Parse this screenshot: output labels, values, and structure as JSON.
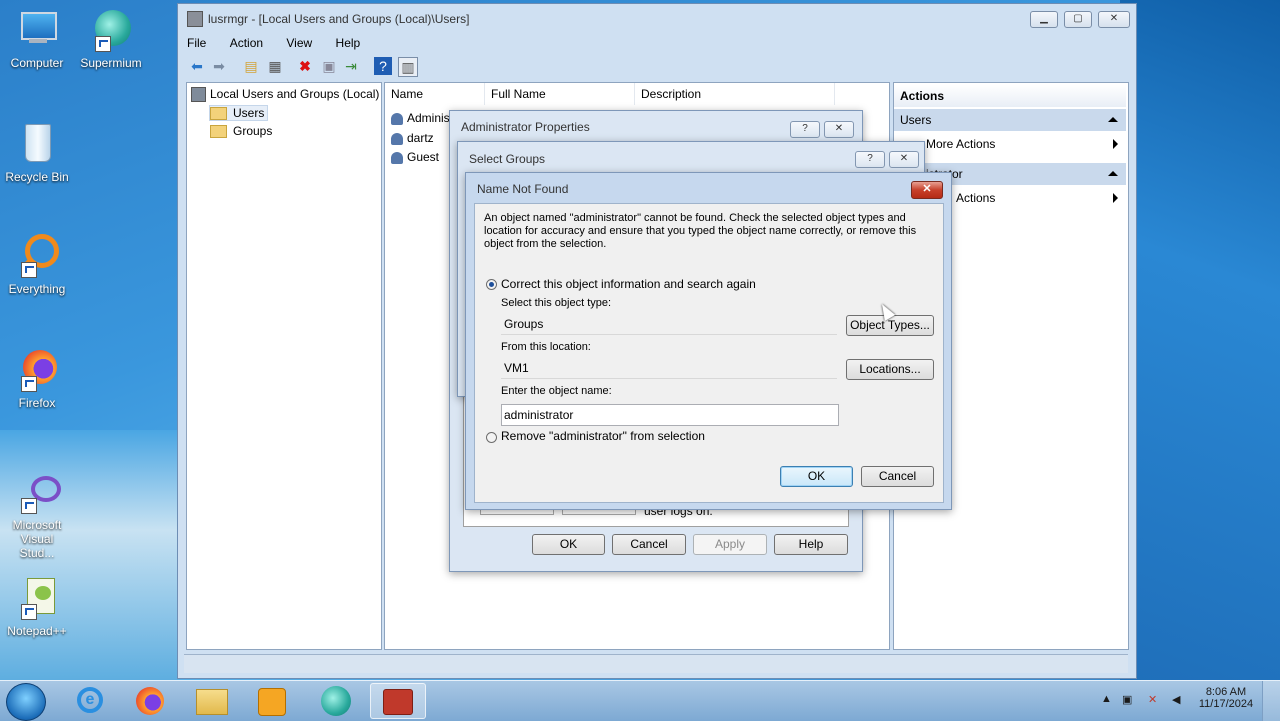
{
  "desktop": {
    "icons": [
      {
        "label": "Computer"
      },
      {
        "label": "Supermium"
      },
      {
        "label": "Recycle Bin"
      },
      {
        "label": "Everything"
      },
      {
        "label": "Firefox"
      },
      {
        "label": "Microsoft\nVisual Stud..."
      },
      {
        "label": "Notepad++"
      }
    ]
  },
  "main_window": {
    "title": "lusrmgr - [Local Users and Groups (Local)\\Users]",
    "menu": [
      "File",
      "Action",
      "View",
      "Help"
    ],
    "tree": {
      "root": "Local Users and Groups (Local)",
      "children": [
        "Users",
        "Groups"
      ]
    },
    "list": {
      "columns": [
        "Name",
        "Full Name",
        "Description"
      ],
      "rows": [
        "Adminis",
        "dartz",
        "Guest"
      ]
    },
    "actions": {
      "header": "Actions",
      "section1": "Users",
      "section1_item": "More Actions",
      "section2": "istrator",
      "section2_item": "Actions"
    }
  },
  "admin_props": {
    "title": "Administrator Properties",
    "help_glyph": "?",
    "close_glyph": "✕",
    "bottom_text": "user logs on.",
    "buttons": {
      "ok": "OK",
      "cancel": "Cancel",
      "apply": "Apply",
      "help": "Help"
    }
  },
  "select_groups": {
    "title": "Select Groups",
    "help_glyph": "?",
    "close_glyph": "✕"
  },
  "name_not_found": {
    "title": "Name Not Found",
    "close_glyph": "✕",
    "message": "An object named \"administrator\" cannot be found. Check the selected object types and location for accuracy and ensure that you typed the object name correctly, or remove this object from the selection.",
    "radio_correct": "Correct this object information and search again",
    "object_type_label": "Select this object type:",
    "object_type_value": "Groups",
    "object_types_button": "Object Types...",
    "location_label": "From this location:",
    "location_value": "VM1",
    "locations_button": "Locations...",
    "object_name_label": "Enter the object name:",
    "object_name_value": "administrator",
    "radio_remove": "Remove \"administrator\" from selection",
    "ok": "OK",
    "cancel": "Cancel"
  },
  "taskbar": {
    "time": "8:06 AM",
    "date": "11/17/2024"
  }
}
